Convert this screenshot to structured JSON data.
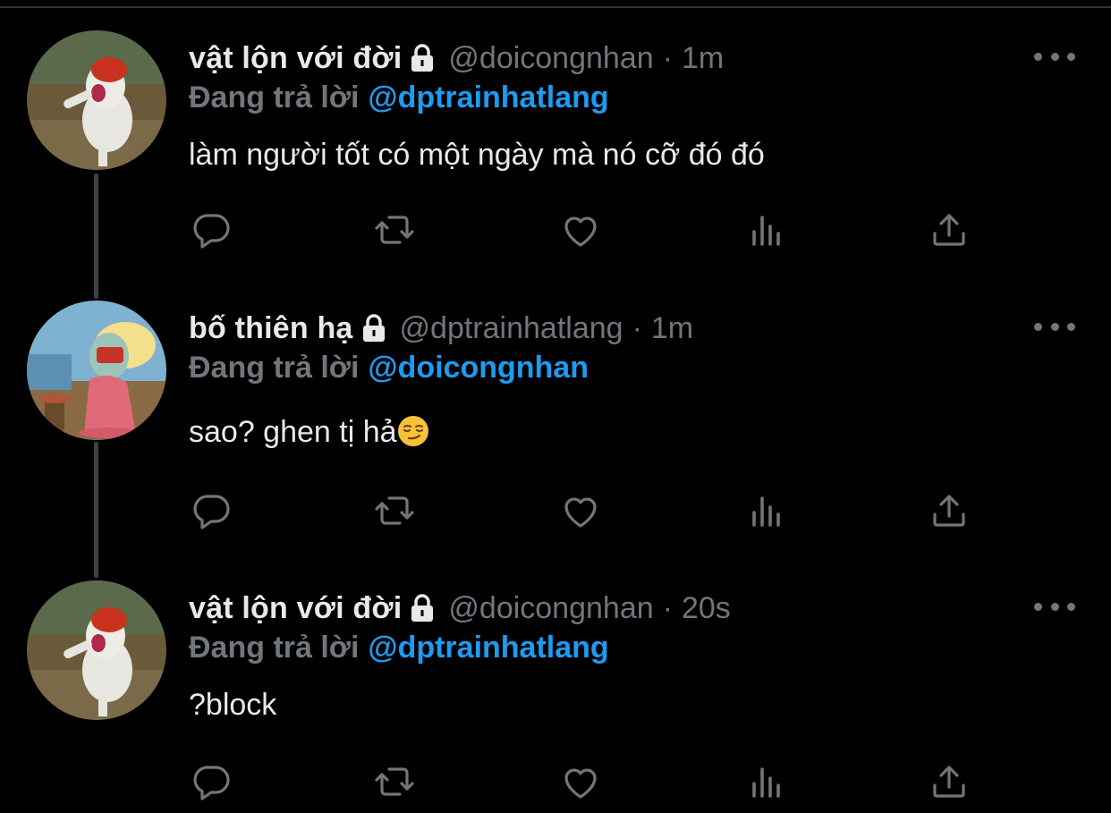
{
  "thread": [
    {
      "author": {
        "name": "vật lộn với đời",
        "handle": "@doicongnhan",
        "time": "1m"
      },
      "replying_label": "Đang trả lời",
      "replying_to": "@dptrainhatlang",
      "text": "làm người tốt có một ngày mà nó cỡ đó đó",
      "avatar": "rabbid-avatar"
    },
    {
      "author": {
        "name": "bố thiên hạ",
        "handle": "@dptrainhatlang",
        "time": "1m"
      },
      "replying_label": "Đang trả lời",
      "replying_to": "@doicongnhan",
      "text": "sao? ghen tị hả",
      "emoji": "smirking-face",
      "avatar": "squidward-avatar"
    },
    {
      "author": {
        "name": "vật lộn với đời",
        "handle": "@doicongnhan",
        "time": "20s"
      },
      "replying_label": "Đang trả lời",
      "replying_to": "@dptrainhatlang",
      "text": "?block",
      "avatar": "rabbid-avatar"
    }
  ],
  "separator": "·",
  "icons": {
    "reply": "reply-icon",
    "retweet": "retweet-icon",
    "like": "like-icon",
    "views": "views-icon",
    "share": "share-icon",
    "more": "more-icon",
    "lock": "lock-icon"
  },
  "colors": {
    "background": "#000000",
    "text": "#e7e9ea",
    "muted": "#71767b",
    "mention": "#1d9bf0",
    "thread_line": "#3e4144"
  }
}
